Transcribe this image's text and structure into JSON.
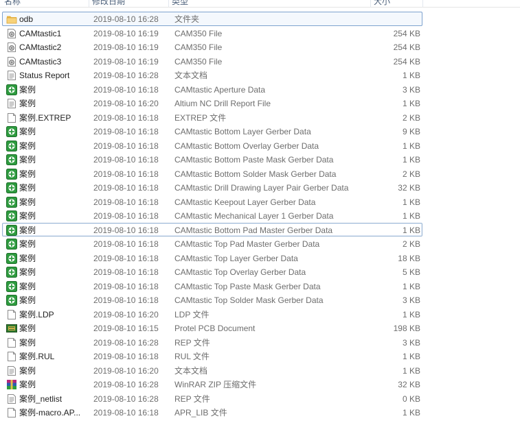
{
  "columns": {
    "name": "名称",
    "date": "修改日期",
    "type": "类型",
    "size": "大小"
  },
  "files": [
    {
      "name": "odb",
      "date": "2019-08-10 16:28",
      "type": "文件夹",
      "size": "",
      "icon": "folder-icon",
      "state": "hl"
    },
    {
      "name": "CAMtastic1",
      "date": "2019-08-10 16:19",
      "type": "CAM350 File",
      "size": "254 KB",
      "icon": "cam-file-icon"
    },
    {
      "name": "CAMtastic2",
      "date": "2019-08-10 16:19",
      "type": "CAM350 File",
      "size": "254 KB",
      "icon": "cam-file-icon"
    },
    {
      "name": "CAMtastic3",
      "date": "2019-08-10 16:19",
      "type": "CAM350 File",
      "size": "254 KB",
      "icon": "cam-file-icon"
    },
    {
      "name": "Status Report",
      "date": "2019-08-10 16:28",
      "type": "文本文档",
      "size": "1 KB",
      "icon": "text-file-icon"
    },
    {
      "name": "案例",
      "date": "2019-08-10 16:18",
      "type": "CAMtastic Aperture Data",
      "size": "3 KB",
      "icon": "gerber-file-icon"
    },
    {
      "name": "案例",
      "date": "2019-08-10 16:20",
      "type": "Altium NC Drill Report File",
      "size": "1 KB",
      "icon": "text-file-icon"
    },
    {
      "name": "案例.EXTREP",
      "date": "2019-08-10 16:18",
      "type": "EXTREP 文件",
      "size": "2 KB",
      "icon": "blank-file-icon"
    },
    {
      "name": "案例",
      "date": "2019-08-10 16:18",
      "type": "CAMtastic Bottom Layer Gerber Data",
      "size": "9 KB",
      "icon": "gerber-file-icon"
    },
    {
      "name": "案例",
      "date": "2019-08-10 16:18",
      "type": "CAMtastic Bottom Overlay Gerber Data",
      "size": "1 KB",
      "icon": "gerber-file-icon"
    },
    {
      "name": "案例",
      "date": "2019-08-10 16:18",
      "type": "CAMtastic Bottom Paste Mask Gerber Data",
      "size": "1 KB",
      "icon": "gerber-file-icon"
    },
    {
      "name": "案例",
      "date": "2019-08-10 16:18",
      "type": "CAMtastic Bottom Solder Mask Gerber Data",
      "size": "2 KB",
      "icon": "gerber-file-icon"
    },
    {
      "name": "案例",
      "date": "2019-08-10 16:18",
      "type": "CAMtastic Drill Drawing Layer Pair Gerber Data",
      "size": "32 KB",
      "icon": "gerber-file-icon"
    },
    {
      "name": "案例",
      "date": "2019-08-10 16:18",
      "type": "CAMtastic Keepout Layer Gerber Data",
      "size": "1 KB",
      "icon": "gerber-file-icon"
    },
    {
      "name": "案例",
      "date": "2019-08-10 16:18",
      "type": "CAMtastic Mechanical Layer 1 Gerber Data",
      "size": "1 KB",
      "icon": "gerber-file-icon"
    },
    {
      "name": "案例",
      "date": "2019-08-10 16:18",
      "type": "CAMtastic Bottom Pad Master Gerber Data",
      "size": "1 KB",
      "icon": "gerber-file-icon",
      "state": "sel"
    },
    {
      "name": "案例",
      "date": "2019-08-10 16:18",
      "type": "CAMtastic Top Pad Master Gerber Data",
      "size": "2 KB",
      "icon": "gerber-file-icon"
    },
    {
      "name": "案例",
      "date": "2019-08-10 16:18",
      "type": "CAMtastic Top Layer Gerber Data",
      "size": "18 KB",
      "icon": "gerber-file-icon"
    },
    {
      "name": "案例",
      "date": "2019-08-10 16:18",
      "type": "CAMtastic Top Overlay Gerber Data",
      "size": "5 KB",
      "icon": "gerber-file-icon"
    },
    {
      "name": "案例",
      "date": "2019-08-10 16:18",
      "type": "CAMtastic Top Paste Mask Gerber Data",
      "size": "1 KB",
      "icon": "gerber-file-icon"
    },
    {
      "name": "案例",
      "date": "2019-08-10 16:18",
      "type": "CAMtastic Top Solder Mask Gerber Data",
      "size": "3 KB",
      "icon": "gerber-file-icon"
    },
    {
      "name": "案例.LDP",
      "date": "2019-08-10 16:20",
      "type": "LDP 文件",
      "size": "1 KB",
      "icon": "blank-file-icon"
    },
    {
      "name": "案例",
      "date": "2019-08-10 16:15",
      "type": "Protel PCB Document",
      "size": "198 KB",
      "icon": "pcb-document-icon"
    },
    {
      "name": "案例",
      "date": "2019-08-10 16:28",
      "type": "REP 文件",
      "size": "3 KB",
      "icon": "blank-file-icon"
    },
    {
      "name": "案例.RUL",
      "date": "2019-08-10 16:18",
      "type": "RUL 文件",
      "size": "1 KB",
      "icon": "blank-file-icon"
    },
    {
      "name": "案例",
      "date": "2019-08-10 16:20",
      "type": "文本文档",
      "size": "1 KB",
      "icon": "text-file-icon"
    },
    {
      "name": "案例",
      "date": "2019-08-10 16:28",
      "type": "WinRAR ZIP 压缩文件",
      "size": "32 KB",
      "icon": "winrar-zip-icon"
    },
    {
      "name": "案例_netlist",
      "date": "2019-08-10 16:28",
      "type": "REP 文件",
      "size": "0 KB",
      "icon": "text-file-icon"
    },
    {
      "name": "案例-macro.AP...",
      "date": "2019-08-10 16:18",
      "type": "APR_LIB 文件",
      "size": "1 KB",
      "icon": "blank-file-icon"
    }
  ]
}
